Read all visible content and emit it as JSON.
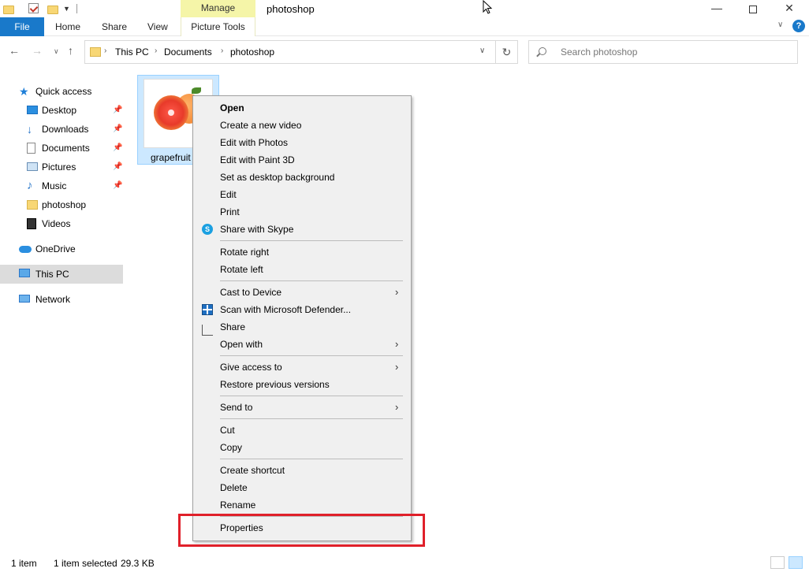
{
  "window": {
    "title": "photoshop",
    "context_tab": "Manage",
    "minimize": "—",
    "close": "✕"
  },
  "ribbon": {
    "file": "File",
    "home": "Home",
    "share": "Share",
    "view": "View",
    "picture_tools": "Picture Tools",
    "help": "?"
  },
  "address": {
    "segments": [
      "This PC",
      "Documents",
      "photoshop"
    ],
    "search_placeholder": "Search photoshop"
  },
  "sidebar": {
    "quick_access": "Quick access",
    "items": [
      "Desktop",
      "Downloads",
      "Documents",
      "Pictures",
      "Music",
      "photoshop",
      "Videos"
    ],
    "onedrive": "OneDrive",
    "this_pc": "This PC",
    "network": "Network"
  },
  "file": {
    "name": "grapefruit"
  },
  "context_menu": {
    "open": "Open",
    "create_video": "Create a new video",
    "edit_photos": "Edit with Photos",
    "edit_paint3d": "Edit with Paint 3D",
    "set_background": "Set as desktop background",
    "edit": "Edit",
    "print": "Print",
    "share_skype": "Share with Skype",
    "rotate_right": "Rotate right",
    "rotate_left": "Rotate left",
    "cast": "Cast to Device",
    "scan": "Scan with Microsoft Defender...",
    "share": "Share",
    "open_with": "Open with",
    "give_access": "Give access to",
    "restore": "Restore previous versions",
    "send_to": "Send to",
    "cut": "Cut",
    "copy": "Copy",
    "create_shortcut": "Create shortcut",
    "delete": "Delete",
    "rename": "Rename",
    "properties": "Properties"
  },
  "status": {
    "count": "1 item",
    "selected": "1 item selected",
    "size": "29.3 KB"
  }
}
